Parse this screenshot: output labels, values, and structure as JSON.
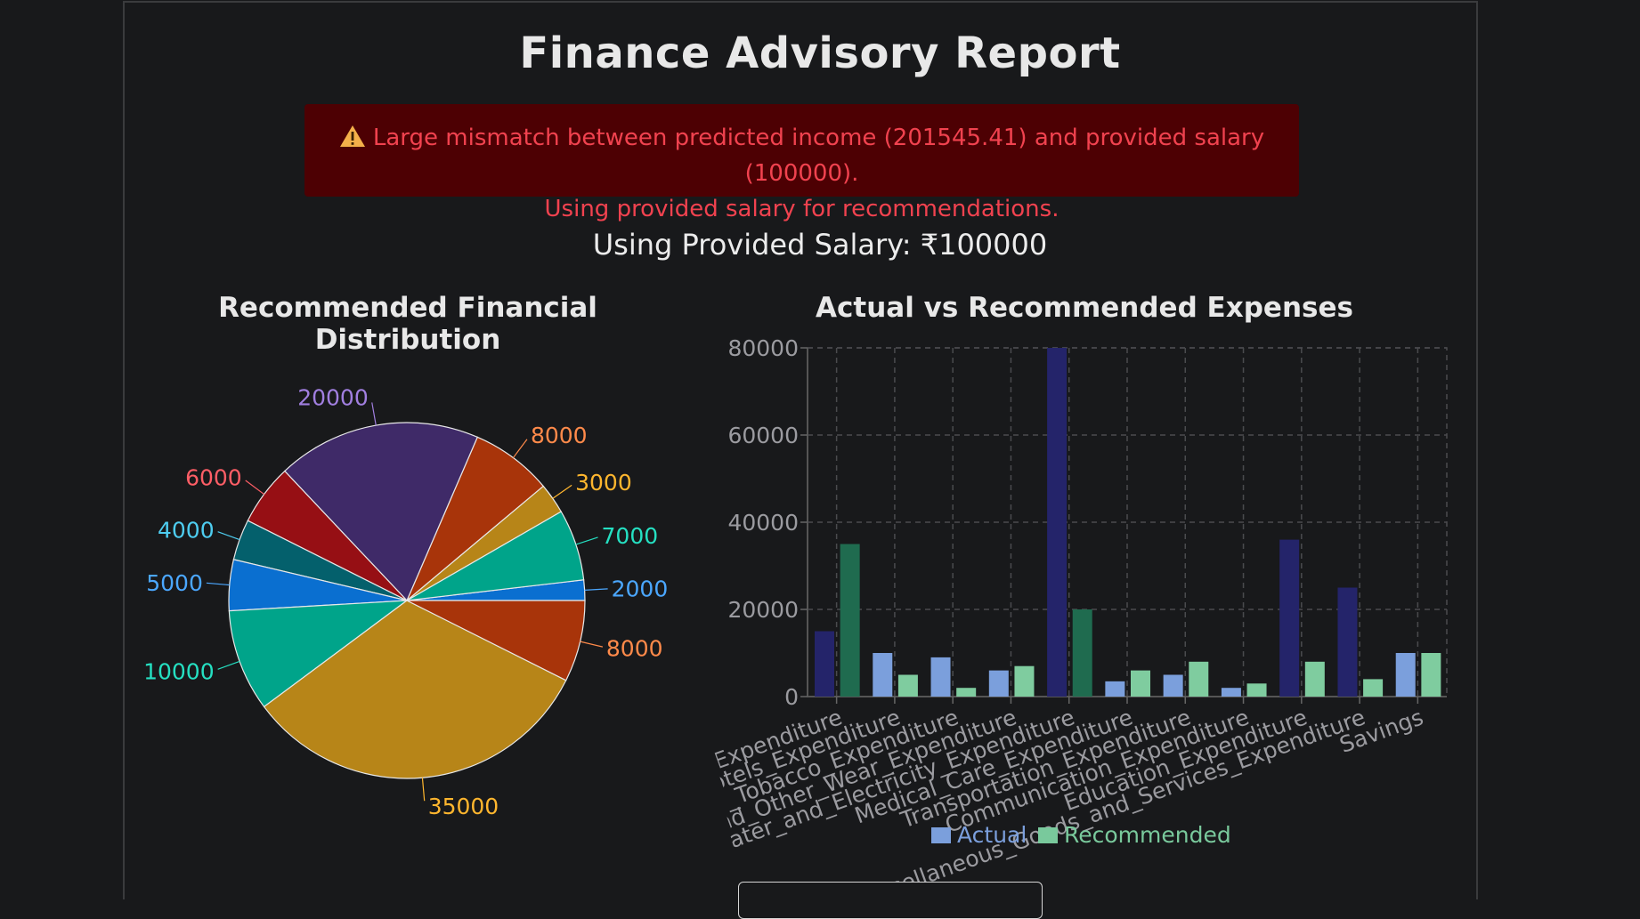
{
  "report": {
    "title": "Finance Advisory Report",
    "alert_line1": "Large mismatch between predicted income (201545.41) and provided salary (100000).",
    "alert_line2": "Using provided salary for recommendations.",
    "salary_text": "Using Provided Salary: ₹100000"
  },
  "colors": {
    "background": "#18191b",
    "alert_bg": "#4d0003",
    "alert_text": "#f1424f",
    "actual_legend": "#7b9fdc",
    "recommended_legend": "#79c99c",
    "actual_bar_dark": "#24246a",
    "recommended_bar_dark": "#1f6b4f",
    "actual_bar_light": "#7b9fdc",
    "recommended_bar_light": "#7fcc9f"
  },
  "chart_data": [
    {
      "type": "pie",
      "title": "Recommended Financial Distribution",
      "slices": [
        {
          "value": 2000,
          "label": "2000",
          "color": "#0a6fd0",
          "label_color": "#4ba7ff"
        },
        {
          "value": 7000,
          "label": "7000",
          "color": "#00a48a",
          "label_color": "#25e0c2"
        },
        {
          "value": 3000,
          "label": "3000",
          "color": "#b78518",
          "label_color": "#ffb62e"
        },
        {
          "value": 8000,
          "label": "8000",
          "color": "#a8340a",
          "label_color": "#ff8a4a"
        },
        {
          "value": 20000,
          "label": "20000",
          "color": "#3f2a68",
          "label_color": "#a17fe0"
        },
        {
          "value": 6000,
          "label": "6000",
          "color": "#960f14",
          "label_color": "#ff5e66"
        },
        {
          "value": 4000,
          "label": "4000",
          "color": "#04606c",
          "label_color": "#4ecdf0"
        },
        {
          "value": 5000,
          "label": "5000",
          "color": "#0a6fd0",
          "label_color": "#4ba7ff"
        },
        {
          "value": 10000,
          "label": "10000",
          "color": "#00a48a",
          "label_color": "#25e0c2"
        },
        {
          "value": 35000,
          "label": "35000",
          "color": "#b78518",
          "label_color": "#ffb62e"
        },
        {
          "value": 8000,
          "label": "8000",
          "color": "#a8340a",
          "label_color": "#ff8a4a"
        }
      ]
    },
    {
      "type": "bar",
      "title": "Actual vs Recommended Expenses",
      "categories": [
        "Food_Expenditure",
        "Restaurant_and_hotels_Expenditure",
        "Alcohol_and_Tobacco_Expenditure",
        "Clothing,_Footwear_and_Other_Wear_Expenditure",
        "Housing_and_water__Water_and_Electricity_Expenditure",
        "Medical_Care_Expenditure",
        "Transportation_Expenditure",
        "Communication_Expenditure",
        "Education_Expenditure",
        "Miscellaneous_Goods_and_Services_Expenditure",
        "Savings"
      ],
      "series": [
        {
          "name": "Actual",
          "values": [
            15000,
            10000,
            9000,
            6000,
            80000,
            3500,
            5000,
            2000,
            36000,
            25000,
            10000
          ],
          "highlight": [
            true,
            false,
            false,
            false,
            true,
            false,
            false,
            false,
            true,
            true,
            false
          ]
        },
        {
          "name": "Recommended",
          "values": [
            35000,
            5000,
            2000,
            7000,
            20000,
            6000,
            8000,
            3000,
            8000,
            4000,
            10000
          ],
          "highlight": [
            true,
            false,
            false,
            false,
            true,
            false,
            false,
            false,
            false,
            false,
            false
          ]
        }
      ],
      "yticks": [
        "0",
        "20000",
        "40000",
        "60000",
        "80000"
      ],
      "ylim": [
        0,
        80000
      ],
      "grid": true,
      "legend": "bottom"
    }
  ]
}
